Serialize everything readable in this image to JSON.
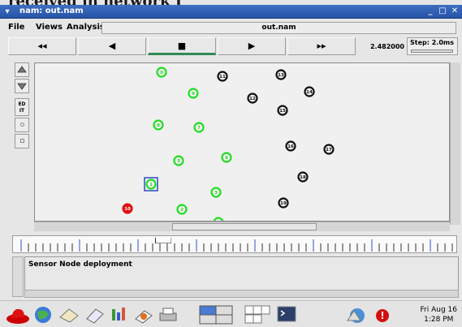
{
  "overlay_text": "received in network I",
  "window": {
    "title": "nam: out.nam",
    "minimize_glyph": "_",
    "maximize_glyph": "□",
    "close_glyph": "✕",
    "menu_glyph": "▾"
  },
  "menubar": {
    "items": [
      "File",
      "Views",
      "Analysis"
    ],
    "file_label": "out.nam"
  },
  "controls": {
    "rewind": "◂◂",
    "back": "◀",
    "stop": "■",
    "play": "▶",
    "fast_forward": "▸▸",
    "time": "2.482000",
    "step_label": "Step: 2.0ms"
  },
  "side_tools": [
    "zoom-in",
    "zoom-out",
    "EDIT",
    "toggle-a",
    "toggle-b"
  ],
  "edit_label": "ED\nIT",
  "nodes": [
    {
      "id": "0",
      "color": "green"
    },
    {
      "id": "11",
      "color": "black"
    },
    {
      "id": "13",
      "color": "black"
    },
    {
      "id": "9",
      "color": "green"
    },
    {
      "id": "14",
      "color": "black"
    },
    {
      "id": "12",
      "color": "black"
    },
    {
      "id": "15",
      "color": "black"
    },
    {
      "id": "8",
      "color": "green"
    },
    {
      "id": "7",
      "color": "green"
    },
    {
      "id": "16",
      "color": "black"
    },
    {
      "id": "17",
      "color": "black"
    },
    {
      "id": "5",
      "color": "green"
    },
    {
      "id": "6",
      "color": "green"
    },
    {
      "id": "18",
      "color": "black"
    },
    {
      "id": "1",
      "color": "green"
    },
    {
      "id": "3",
      "color": "green"
    },
    {
      "id": "19",
      "color": "black"
    },
    {
      "id": "10",
      "color": "red"
    },
    {
      "id": "2",
      "color": "green"
    },
    {
      "id": "4",
      "color": "green"
    }
  ],
  "colors": {
    "green": "#22dd22",
    "black": "#111111",
    "red": "#e01010",
    "selection": "#2040c0",
    "titlebar": "#2d5cb0"
  },
  "timeline": {
    "label": "████"
  },
  "annotation": {
    "text": "Sensor Node deployment"
  },
  "clock": {
    "date": "Fri Aug 16",
    "time": "1:28 PM"
  }
}
